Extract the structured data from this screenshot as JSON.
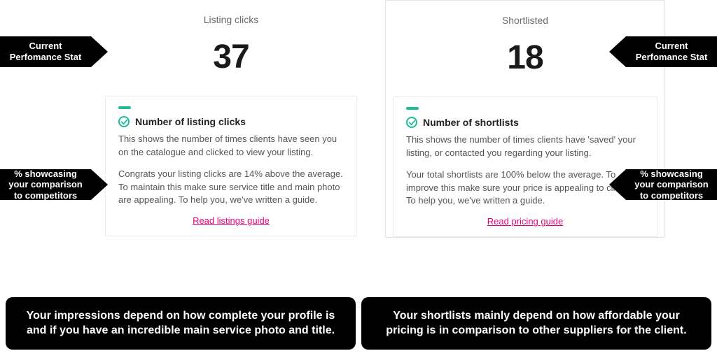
{
  "left_stat": {
    "title": "Listing clicks",
    "value": "37",
    "card": {
      "heading": "Number of listing clicks",
      "p1": "This shows the number of times clients have seen you on the catalogue and clicked to view your listing.",
      "p2": "Congrats your listing clicks are 14% above the average. To maintain this make sure service title and main photo are appealing. To help you, we've written a guide.",
      "link": "Read listings guide"
    }
  },
  "right_stat": {
    "title": "Shortlisted",
    "value": "18",
    "card": {
      "heading": "Number of shortlists",
      "p1": "This shows the number of times clients have 'saved' your listing, or contacted you regarding your listing.",
      "p2": "Your total shortlists are 100% below the average. To improve this make sure your price is appealing to clients. To help you, we've written a guide.",
      "link": "Read pricing guide"
    }
  },
  "callouts": {
    "current_stat": "Current Perfomance Stat",
    "comparison": "% showcasing your comparison to competitors"
  },
  "bottom": {
    "left": "Your impressions depend on how complete your profile is and if you have an incredible main service photo and title.",
    "right": "Your shortlists mainly depend on how affordable your pricing is in comparison to other suppliers for the client."
  }
}
